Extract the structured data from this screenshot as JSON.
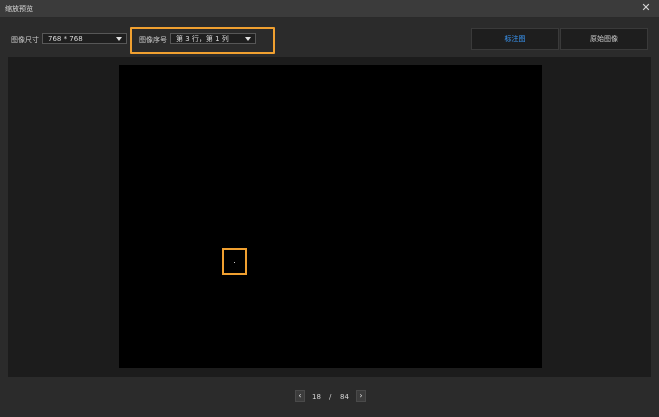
{
  "window": {
    "title": "缩放预览",
    "close_icon": "close-icon"
  },
  "toolbar": {
    "image_size_label": "图像尺寸",
    "image_size_value": "768 * 768",
    "image_index_label": "图像序号",
    "image_index_value": "第 3 行，第 1 列",
    "tab_annotated": "标注图",
    "tab_original": "原始图像",
    "active_tab": "标注图"
  },
  "pager": {
    "current": "18",
    "separator": "/",
    "total": "84"
  },
  "colors": {
    "accent": "#3b9cff",
    "highlight": "#f0a030",
    "canvas": "#000000"
  }
}
